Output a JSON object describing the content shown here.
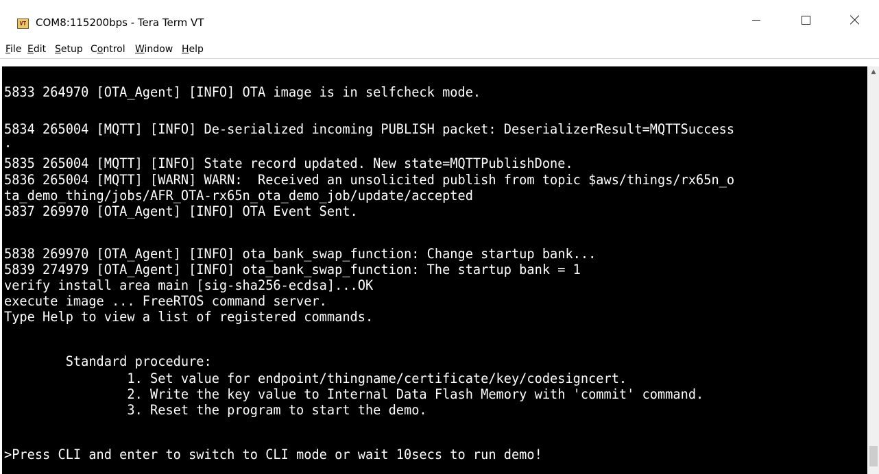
{
  "window": {
    "icon_label": "VT",
    "title": "COM8:115200bps - Tera Term VT"
  },
  "menu": {
    "items": [
      {
        "accel": "F",
        "rest": "ile"
      },
      {
        "accel": "E",
        "rest": "dit"
      },
      {
        "accel": "S",
        "rest": "etup"
      },
      {
        "pre": "C",
        "accel": "o",
        "rest": "ntrol"
      },
      {
        "accel": "W",
        "rest": "indow"
      },
      {
        "accel": "H",
        "rest": "elp"
      }
    ]
  },
  "terminal": {
    "lines": [
      "5833 264970 [OTA_Agent] [INFO] OTA image is in selfcheck mode.",
      "5834 265004 [MQTT] [INFO] De-serialized incoming PUBLISH packet: DeserializerResult=MQTTSuccess",
      ".",
      "5835 265004 [MQTT] [INFO] State record updated. New state=MQTTPublishDone.",
      "5836 265004 [MQTT] [WARN] WARN:  Received an unsolicited publish from topic $aws/things/rx65n_o",
      "ta_demo_thing/jobs/AFR_OTA-rx65n_ota_demo_job/update/accepted",
      "5837 269970 [OTA_Agent] [INFO] OTA Event Sent.",
      "5838 269970 [OTA_Agent] [INFO] ota_bank_swap_function: Change startup bank...",
      "5839 274979 [OTA_Agent] [INFO] ota_bank_swap_function: The startup bank = 1",
      "verify install area main [sig-sha256-ecdsa]...OK",
      "execute image ... FreeRTOS command server.",
      "Type Help to view a list of registered commands.",
      "        Standard procedure:",
      "                1. Set value for endpoint/thingname/certificate/key/codesigncert.",
      "                2. Write the key value to Internal Data Flash Memory with 'commit' command.",
      "                3. Reset the program to start the demo.",
      ">Press CLI and enter to switch to CLI mode or wait 10secs to run demo!"
    ]
  }
}
